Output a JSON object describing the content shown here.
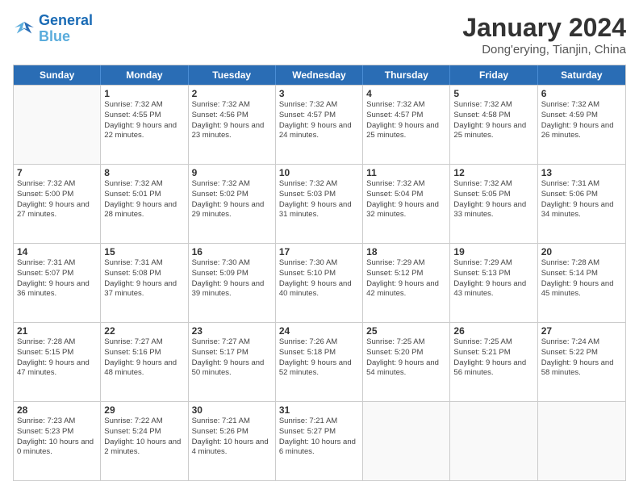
{
  "logo": {
    "line1": "General",
    "line2": "Blue"
  },
  "title": "January 2024",
  "subtitle": "Dong'erying, Tianjin, China",
  "days": [
    "Sunday",
    "Monday",
    "Tuesday",
    "Wednesday",
    "Thursday",
    "Friday",
    "Saturday"
  ],
  "weeks": [
    [
      {
        "day": "",
        "empty": true
      },
      {
        "day": "1",
        "sunrise": "7:32 AM",
        "sunset": "4:55 PM",
        "daylight": "9 hours and 22 minutes."
      },
      {
        "day": "2",
        "sunrise": "7:32 AM",
        "sunset": "4:56 PM",
        "daylight": "9 hours and 23 minutes."
      },
      {
        "day": "3",
        "sunrise": "7:32 AM",
        "sunset": "4:57 PM",
        "daylight": "9 hours and 24 minutes."
      },
      {
        "day": "4",
        "sunrise": "7:32 AM",
        "sunset": "4:57 PM",
        "daylight": "9 hours and 25 minutes."
      },
      {
        "day": "5",
        "sunrise": "7:32 AM",
        "sunset": "4:58 PM",
        "daylight": "9 hours and 25 minutes."
      },
      {
        "day": "6",
        "sunrise": "7:32 AM",
        "sunset": "4:59 PM",
        "daylight": "9 hours and 26 minutes."
      }
    ],
    [
      {
        "day": "7",
        "sunrise": "7:32 AM",
        "sunset": "5:00 PM",
        "daylight": "9 hours and 27 minutes."
      },
      {
        "day": "8",
        "sunrise": "7:32 AM",
        "sunset": "5:01 PM",
        "daylight": "9 hours and 28 minutes."
      },
      {
        "day": "9",
        "sunrise": "7:32 AM",
        "sunset": "5:02 PM",
        "daylight": "9 hours and 29 minutes."
      },
      {
        "day": "10",
        "sunrise": "7:32 AM",
        "sunset": "5:03 PM",
        "daylight": "9 hours and 31 minutes."
      },
      {
        "day": "11",
        "sunrise": "7:32 AM",
        "sunset": "5:04 PM",
        "daylight": "9 hours and 32 minutes."
      },
      {
        "day": "12",
        "sunrise": "7:32 AM",
        "sunset": "5:05 PM",
        "daylight": "9 hours and 33 minutes."
      },
      {
        "day": "13",
        "sunrise": "7:31 AM",
        "sunset": "5:06 PM",
        "daylight": "9 hours and 34 minutes."
      }
    ],
    [
      {
        "day": "14",
        "sunrise": "7:31 AM",
        "sunset": "5:07 PM",
        "daylight": "9 hours and 36 minutes."
      },
      {
        "day": "15",
        "sunrise": "7:31 AM",
        "sunset": "5:08 PM",
        "daylight": "9 hours and 37 minutes."
      },
      {
        "day": "16",
        "sunrise": "7:30 AM",
        "sunset": "5:09 PM",
        "daylight": "9 hours and 39 minutes."
      },
      {
        "day": "17",
        "sunrise": "7:30 AM",
        "sunset": "5:10 PM",
        "daylight": "9 hours and 40 minutes."
      },
      {
        "day": "18",
        "sunrise": "7:29 AM",
        "sunset": "5:12 PM",
        "daylight": "9 hours and 42 minutes."
      },
      {
        "day": "19",
        "sunrise": "7:29 AM",
        "sunset": "5:13 PM",
        "daylight": "9 hours and 43 minutes."
      },
      {
        "day": "20",
        "sunrise": "7:28 AM",
        "sunset": "5:14 PM",
        "daylight": "9 hours and 45 minutes."
      }
    ],
    [
      {
        "day": "21",
        "sunrise": "7:28 AM",
        "sunset": "5:15 PM",
        "daylight": "9 hours and 47 minutes."
      },
      {
        "day": "22",
        "sunrise": "7:27 AM",
        "sunset": "5:16 PM",
        "daylight": "9 hours and 48 minutes."
      },
      {
        "day": "23",
        "sunrise": "7:27 AM",
        "sunset": "5:17 PM",
        "daylight": "9 hours and 50 minutes."
      },
      {
        "day": "24",
        "sunrise": "7:26 AM",
        "sunset": "5:18 PM",
        "daylight": "9 hours and 52 minutes."
      },
      {
        "day": "25",
        "sunrise": "7:25 AM",
        "sunset": "5:20 PM",
        "daylight": "9 hours and 54 minutes."
      },
      {
        "day": "26",
        "sunrise": "7:25 AM",
        "sunset": "5:21 PM",
        "daylight": "9 hours and 56 minutes."
      },
      {
        "day": "27",
        "sunrise": "7:24 AM",
        "sunset": "5:22 PM",
        "daylight": "9 hours and 58 minutes."
      }
    ],
    [
      {
        "day": "28",
        "sunrise": "7:23 AM",
        "sunset": "5:23 PM",
        "daylight": "10 hours and 0 minutes."
      },
      {
        "day": "29",
        "sunrise": "7:22 AM",
        "sunset": "5:24 PM",
        "daylight": "10 hours and 2 minutes."
      },
      {
        "day": "30",
        "sunrise": "7:21 AM",
        "sunset": "5:26 PM",
        "daylight": "10 hours and 4 minutes."
      },
      {
        "day": "31",
        "sunrise": "7:21 AM",
        "sunset": "5:27 PM",
        "daylight": "10 hours and 6 minutes."
      },
      {
        "day": "",
        "empty": true
      },
      {
        "day": "",
        "empty": true
      },
      {
        "day": "",
        "empty": true
      }
    ]
  ]
}
